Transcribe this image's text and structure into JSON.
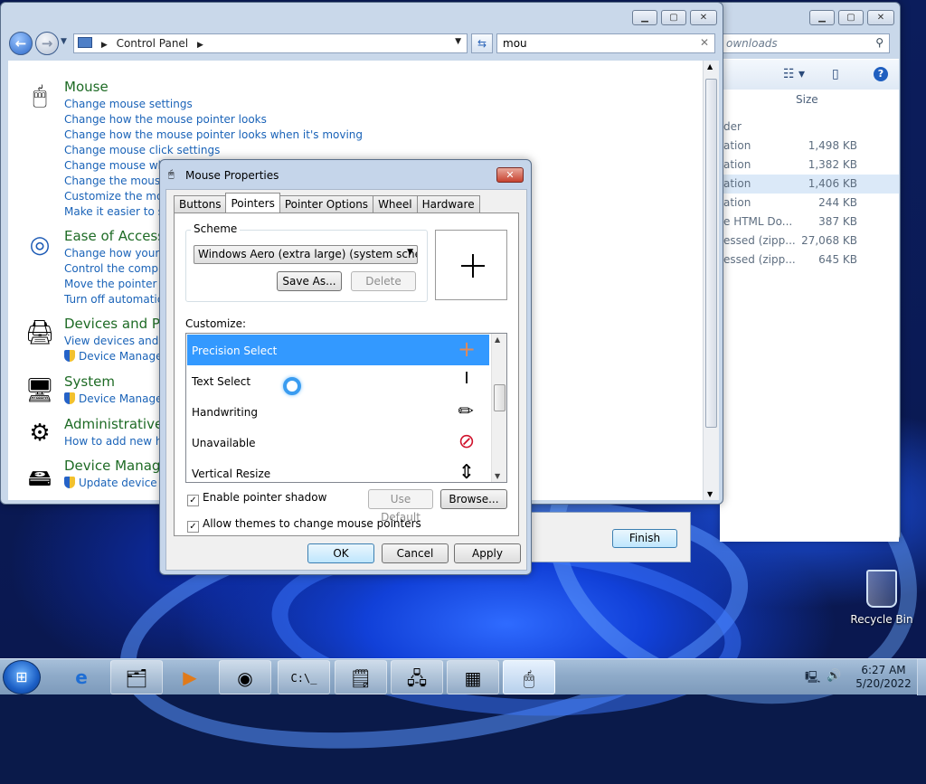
{
  "control_panel": {
    "address_path": "Control Panel",
    "search_query": "mou",
    "categories": [
      {
        "title": "Mouse",
        "links": [
          "Change mouse settings",
          "Change how the mouse pointer looks",
          "Change how the mouse pointer looks when it's moving",
          "Change mouse click settings",
          "Change mouse whe",
          "Change the mouse p",
          "Customize the mou",
          "Make it easier to see"
        ]
      },
      {
        "title": "Ease of Access C",
        "links": [
          "Change how your m",
          "Control the comput",
          "Move the pointer wi",
          "Turn off automatic w"
        ]
      },
      {
        "title": "Devices and Pri",
        "links": [
          "View devices and pr",
          "Device Manager"
        ]
      },
      {
        "title": "System",
        "links": [
          "Device Manager"
        ]
      },
      {
        "title": "Administrative",
        "links": [
          "How to add new ha"
        ]
      },
      {
        "title": "Device Manage",
        "links": [
          "Update device dr"
        ]
      }
    ]
  },
  "explorer": {
    "search_placeholder": "ownloads",
    "size_header": "Size",
    "rows": [
      {
        "type": "der",
        "size": ""
      },
      {
        "type": "ation",
        "size": "1,498 KB"
      },
      {
        "type": "ation",
        "size": "1,382 KB"
      },
      {
        "type": "ation",
        "size": "1,406 KB"
      },
      {
        "type": "ation",
        "size": "244 KB"
      },
      {
        "type": "e HTML Do...",
        "size": "387 KB"
      },
      {
        "type": "essed (zipp...",
        "size": "27,068 KB"
      },
      {
        "type": "essed (zipp...",
        "size": "645 KB"
      }
    ]
  },
  "wizard": {
    "finish_label": "Finish"
  },
  "dialog": {
    "title": "Mouse Properties",
    "tabs": [
      "Buttons",
      "Pointers",
      "Pointer Options",
      "Wheel",
      "Hardware"
    ],
    "active_tab": "Pointers",
    "scheme_label": "Scheme",
    "scheme_value": "Windows Aero (extra large) (system scheme)",
    "save_as_label": "Save As...",
    "delete_label": "Delete",
    "customize_label": "Customize:",
    "cursors": [
      {
        "label": "Precision Select",
        "glyph": "crosshair"
      },
      {
        "label": "Text Select",
        "glyph": "ibeam"
      },
      {
        "label": "Handwriting",
        "glyph": "pen"
      },
      {
        "label": "Unavailable",
        "glyph": "no"
      },
      {
        "label": "Vertical Resize",
        "glyph": "vresize"
      }
    ],
    "selected_cursor": "Precision Select",
    "enable_shadow_label": "Enable pointer shadow",
    "enable_shadow_checked": true,
    "use_default_label": "Use Default",
    "browse_label": "Browse...",
    "allow_themes_label": "Allow themes to change mouse pointers",
    "allow_themes_checked": true,
    "ok_label": "OK",
    "cancel_label": "Cancel",
    "apply_label": "Apply"
  },
  "desktop": {
    "recycle_bin_label": "Recycle Bin"
  },
  "taskbar": {
    "time": "6:27 AM",
    "date": "5/20/2022",
    "items": [
      "internet-explorer",
      "file-explorer",
      "media-player",
      "chrome",
      "command-prompt",
      "notepad",
      "network",
      "control-panel",
      "mouse-properties"
    ]
  }
}
